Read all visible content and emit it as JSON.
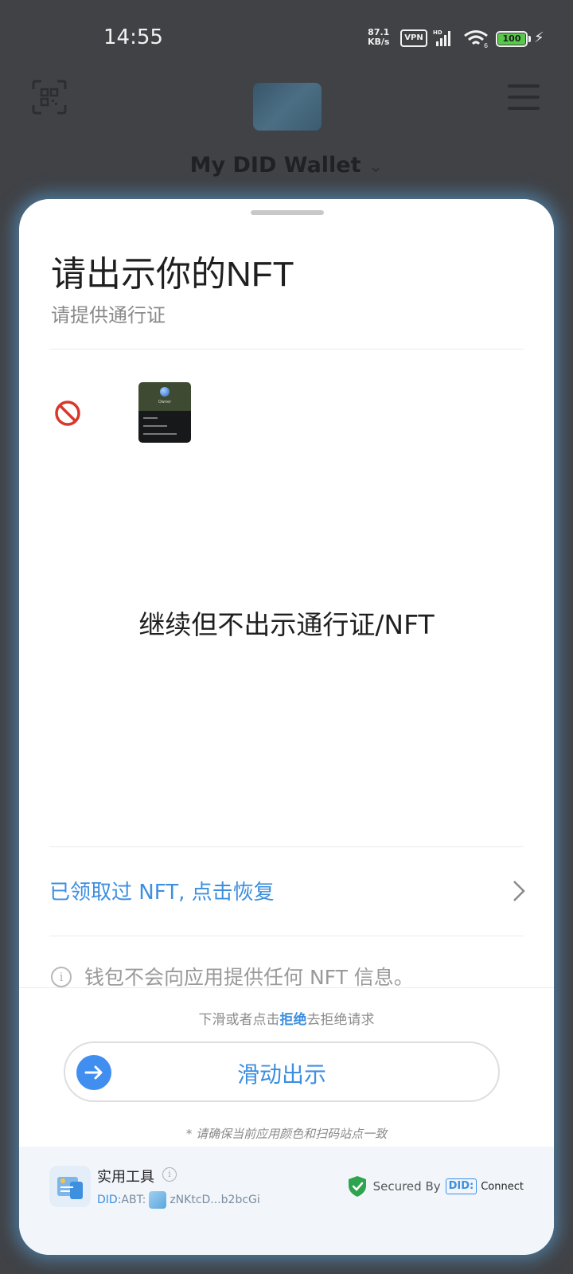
{
  "status_bar": {
    "time": "14:55",
    "net_speed_value": "87.1",
    "net_speed_unit": "KB/s",
    "vpn": "VPN",
    "signal_tag": "HD",
    "wifi_tag": "6",
    "battery": "100"
  },
  "header": {
    "wallet_title": "My DID Wallet",
    "icons": [
      "scan-icon",
      "menu-icon",
      "chevron-down-icon"
    ]
  },
  "sheet": {
    "title": "请出示你的NFT",
    "subtitle": "请提供通行证",
    "nft_card_text": "Owner",
    "skip_option": "继续但不出示通行证/NFT",
    "restore_link": "已领取过 NFT, 点击恢复",
    "info_text": "钱包不会向应用提供任何 NFT 信息。",
    "reject_hint_before": "下滑或者点击",
    "reject_hint_link": "拒绝",
    "reject_hint_after": "去拒绝请求",
    "slider_label": "滑动出示",
    "consistency_note": "* 请确保当前应用颜色和扫码站点一致"
  },
  "footer": {
    "app_name": "实用工具",
    "did_prefix": "DID:",
    "did_type": "ABT:",
    "did_value": "zNKtcD...b2bcGi",
    "secured_by": "Secured By",
    "did_logo": "DID:",
    "connect": "Connect"
  },
  "colors": {
    "accent": "#3d8fe0",
    "backdrop": "#404246",
    "shield": "#2ea44f"
  }
}
